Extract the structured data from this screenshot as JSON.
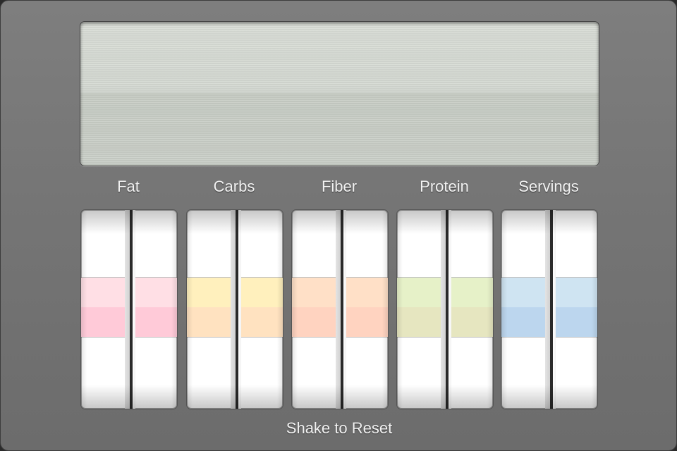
{
  "display": {
    "readout": ""
  },
  "columns": [
    {
      "label": "Fat",
      "band_top": "#ffdfe5",
      "band_bottom": "#ffcad8"
    },
    {
      "label": "Carbs",
      "band_top": "#fff0bd",
      "band_bottom": "#ffe2c0"
    },
    {
      "label": "Fiber",
      "band_top": "#ffe0c7",
      "band_bottom": "#ffd3c0"
    },
    {
      "label": "Protein",
      "band_top": "#e6f1c8",
      "band_bottom": "#e6e6c0"
    },
    {
      "label": "Servings",
      "band_top": "#cfe4f2",
      "band_bottom": "#bcd6ee"
    }
  ],
  "footer": {
    "label": "Shake to Reset"
  }
}
